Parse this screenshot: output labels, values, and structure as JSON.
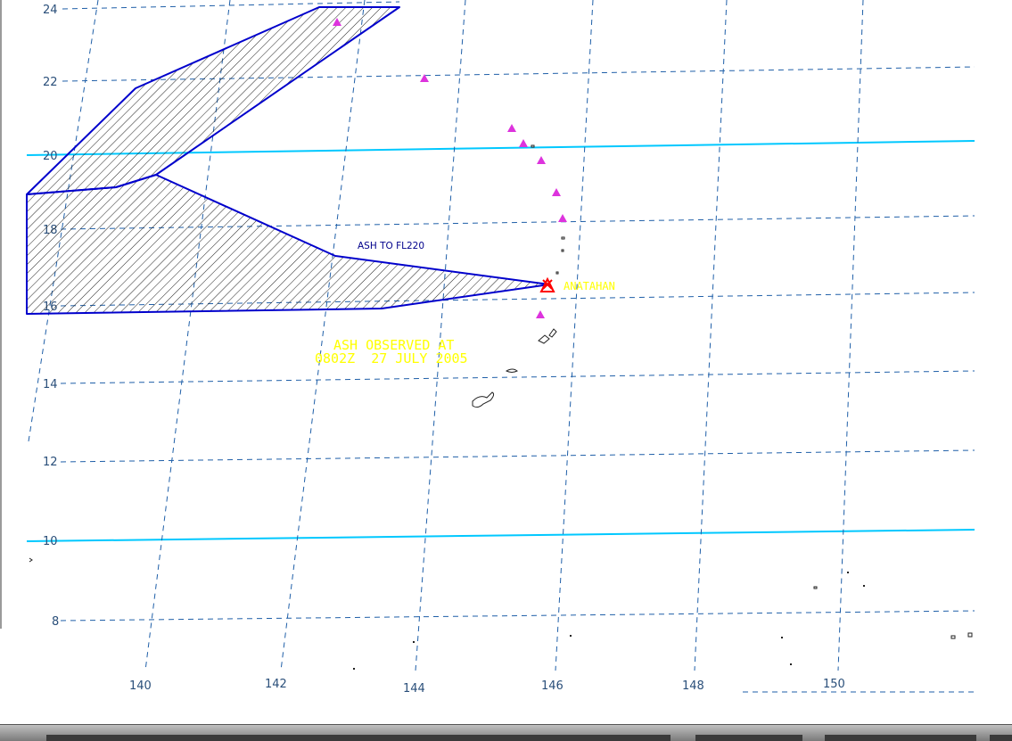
{
  "map": {
    "lat_labels": [
      "24",
      "22",
      "20",
      "18",
      "16",
      "14",
      "12",
      "10",
      "8"
    ],
    "lon_labels": [
      "140",
      "142",
      "144",
      "146",
      "148",
      "150"
    ],
    "annotations": {
      "ash_height": "ASH TO FL220",
      "observed_line1": "ASH OBSERVED AT",
      "observed_line2": "0802Z  27 JULY 2005",
      "volcano_name": "ANATAHAN"
    },
    "colors": {
      "grid": "#1f5fa8",
      "highlight_latitude": "#00c8ff",
      "ash_polygon": "#0000cc",
      "volcano_marker": "#dd33dd",
      "active_volcano": "#ff0000",
      "annotation_text": "#ffff00"
    },
    "icons": {
      "volcano": "triangle-icon",
      "active_volcano": "erupting-volcano-icon"
    }
  }
}
